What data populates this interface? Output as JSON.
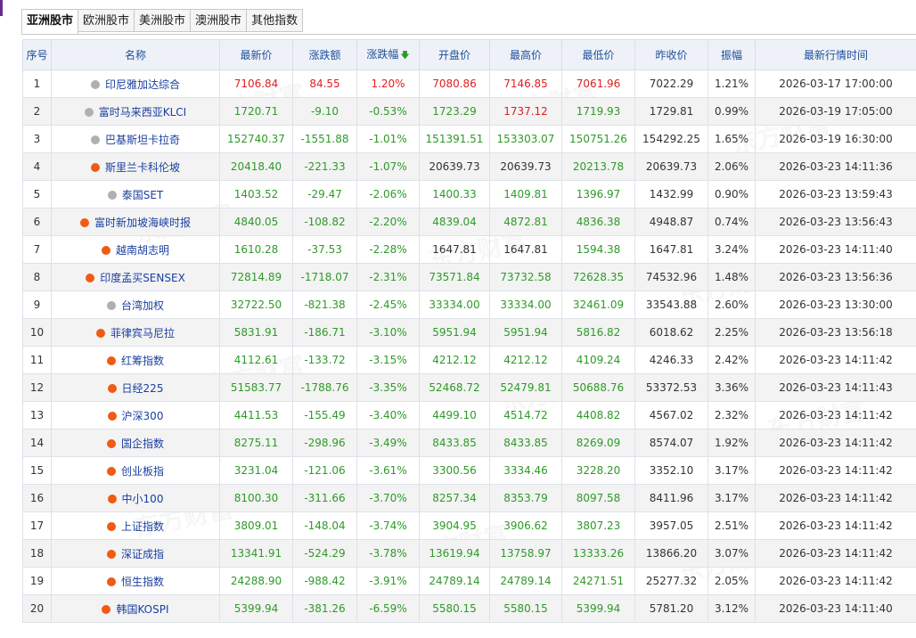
{
  "tabs": [
    "亚洲股市",
    "欧洲股市",
    "美洲股市",
    "澳洲股市",
    "其他指数"
  ],
  "active_tab": 0,
  "watermark": "东方财富",
  "columns": [
    "序号",
    "名称",
    "最新价",
    "涨跌额",
    "涨跌幅",
    "开盘价",
    "最高价",
    "最低价",
    "昨收价",
    "振幅",
    "最新行情时间"
  ],
  "colors": {
    "up": "#e02020",
    "down": "#2e9a28",
    "status_open": "#f05a14",
    "status_closed": "#b0b0b0",
    "header_text": "#1f4f9a"
  },
  "rows": [
    {
      "no": "1",
      "status": "closed",
      "name": "印尼雅加达综合",
      "price": "7106.84",
      "chg": "84.55",
      "pct": "1.20%",
      "open": "7080.86",
      "high": "7146.85",
      "low": "7061.96",
      "prev": "7022.29",
      "amp": "1.21%",
      "time": "2026-03-17 17:00:00",
      "c": {
        "price": "up",
        "chg": "up",
        "pct": "up",
        "open": "up",
        "high": "up",
        "low": "up"
      }
    },
    {
      "no": "2",
      "status": "closed",
      "name": "富时马来西亚KLCI",
      "price": "1720.71",
      "chg": "-9.10",
      "pct": "-0.53%",
      "open": "1723.29",
      "high": "1737.12",
      "low": "1719.93",
      "prev": "1729.81",
      "amp": "0.99%",
      "time": "2026-03-19 17:05:00",
      "c": {
        "price": "down",
        "chg": "down",
        "pct": "down",
        "open": "down",
        "high": "up",
        "low": "down"
      }
    },
    {
      "no": "3",
      "status": "closed",
      "name": "巴基斯坦卡拉奇",
      "price": "152740.37",
      "chg": "-1551.88",
      "pct": "-1.01%",
      "open": "151391.51",
      "high": "153303.07",
      "low": "150751.26",
      "prev": "154292.25",
      "amp": "1.65%",
      "time": "2026-03-19 16:30:00",
      "c": {
        "price": "down",
        "chg": "down",
        "pct": "down",
        "open": "down",
        "high": "down",
        "low": "down"
      }
    },
    {
      "no": "4",
      "status": "open",
      "name": "斯里兰卡科伦坡",
      "price": "20418.40",
      "chg": "-221.33",
      "pct": "-1.07%",
      "open": "20639.73",
      "high": "20639.73",
      "low": "20213.78",
      "prev": "20639.73",
      "amp": "2.06%",
      "time": "2026-03-23 14:11:36",
      "c": {
        "price": "down",
        "chg": "down",
        "pct": "down",
        "open": "flat",
        "high": "flat",
        "low": "down"
      }
    },
    {
      "no": "5",
      "status": "closed",
      "name": "泰国SET",
      "price": "1403.52",
      "chg": "-29.47",
      "pct": "-2.06%",
      "open": "1400.33",
      "high": "1409.81",
      "low": "1396.97",
      "prev": "1432.99",
      "amp": "0.90%",
      "time": "2026-03-23 13:59:43",
      "c": {
        "price": "down",
        "chg": "down",
        "pct": "down",
        "open": "down",
        "high": "down",
        "low": "down"
      }
    },
    {
      "no": "6",
      "status": "open",
      "name": "富时新加坡海峡时报",
      "price": "4840.05",
      "chg": "-108.82",
      "pct": "-2.20%",
      "open": "4839.04",
      "high": "4872.81",
      "low": "4836.38",
      "prev": "4948.87",
      "amp": "0.74%",
      "time": "2026-03-23 13:56:43",
      "c": {
        "price": "down",
        "chg": "down",
        "pct": "down",
        "open": "down",
        "high": "down",
        "low": "down"
      }
    },
    {
      "no": "7",
      "status": "open",
      "name": "越南胡志明",
      "price": "1610.28",
      "chg": "-37.53",
      "pct": "-2.28%",
      "open": "1647.81",
      "high": "1647.81",
      "low": "1594.38",
      "prev": "1647.81",
      "amp": "3.24%",
      "time": "2026-03-23 14:11:40",
      "c": {
        "price": "down",
        "chg": "down",
        "pct": "down",
        "open": "flat",
        "high": "flat",
        "low": "down"
      }
    },
    {
      "no": "8",
      "status": "open",
      "name": "印度孟买SENSEX",
      "price": "72814.89",
      "chg": "-1718.07",
      "pct": "-2.31%",
      "open": "73571.84",
      "high": "73732.58",
      "low": "72628.35",
      "prev": "74532.96",
      "amp": "1.48%",
      "time": "2026-03-23 13:56:36",
      "c": {
        "price": "down",
        "chg": "down",
        "pct": "down",
        "open": "down",
        "high": "down",
        "low": "down"
      }
    },
    {
      "no": "9",
      "status": "closed",
      "name": "台湾加权",
      "price": "32722.50",
      "chg": "-821.38",
      "pct": "-2.45%",
      "open": "33334.00",
      "high": "33334.00",
      "low": "32461.09",
      "prev": "33543.88",
      "amp": "2.60%",
      "time": "2026-03-23 13:30:00",
      "c": {
        "price": "down",
        "chg": "down",
        "pct": "down",
        "open": "down",
        "high": "down",
        "low": "down"
      }
    },
    {
      "no": "10",
      "status": "open",
      "name": "菲律宾马尼拉",
      "price": "5831.91",
      "chg": "-186.71",
      "pct": "-3.10%",
      "open": "5951.94",
      "high": "5951.94",
      "low": "5816.82",
      "prev": "6018.62",
      "amp": "2.25%",
      "time": "2026-03-23 13:56:18",
      "c": {
        "price": "down",
        "chg": "down",
        "pct": "down",
        "open": "down",
        "high": "down",
        "low": "down"
      }
    },
    {
      "no": "11",
      "status": "open",
      "name": "红筹指数",
      "price": "4112.61",
      "chg": "-133.72",
      "pct": "-3.15%",
      "open": "4212.12",
      "high": "4212.12",
      "low": "4109.24",
      "prev": "4246.33",
      "amp": "2.42%",
      "time": "2026-03-23 14:11:42",
      "c": {
        "price": "down",
        "chg": "down",
        "pct": "down",
        "open": "down",
        "high": "down",
        "low": "down"
      }
    },
    {
      "no": "12",
      "status": "open",
      "name": "日经225",
      "price": "51583.77",
      "chg": "-1788.76",
      "pct": "-3.35%",
      "open": "52468.72",
      "high": "52479.81",
      "low": "50688.76",
      "prev": "53372.53",
      "amp": "3.36%",
      "time": "2026-03-23 14:11:43",
      "c": {
        "price": "down",
        "chg": "down",
        "pct": "down",
        "open": "down",
        "high": "down",
        "low": "down"
      }
    },
    {
      "no": "13",
      "status": "open",
      "name": "沪深300",
      "price": "4411.53",
      "chg": "-155.49",
      "pct": "-3.40%",
      "open": "4499.10",
      "high": "4514.72",
      "low": "4408.82",
      "prev": "4567.02",
      "amp": "2.32%",
      "time": "2026-03-23 14:11:42",
      "c": {
        "price": "down",
        "chg": "down",
        "pct": "down",
        "open": "down",
        "high": "down",
        "low": "down"
      }
    },
    {
      "no": "14",
      "status": "open",
      "name": "国企指数",
      "price": "8275.11",
      "chg": "-298.96",
      "pct": "-3.49%",
      "open": "8433.85",
      "high": "8433.85",
      "low": "8269.09",
      "prev": "8574.07",
      "amp": "1.92%",
      "time": "2026-03-23 14:11:42",
      "c": {
        "price": "down",
        "chg": "down",
        "pct": "down",
        "open": "down",
        "high": "down",
        "low": "down"
      }
    },
    {
      "no": "15",
      "status": "open",
      "name": "创业板指",
      "price": "3231.04",
      "chg": "-121.06",
      "pct": "-3.61%",
      "open": "3300.56",
      "high": "3334.46",
      "low": "3228.20",
      "prev": "3352.10",
      "amp": "3.17%",
      "time": "2026-03-23 14:11:42",
      "c": {
        "price": "down",
        "chg": "down",
        "pct": "down",
        "open": "down",
        "high": "down",
        "low": "down"
      }
    },
    {
      "no": "16",
      "status": "open",
      "name": "中小100",
      "price": "8100.30",
      "chg": "-311.66",
      "pct": "-3.70%",
      "open": "8257.34",
      "high": "8353.79",
      "low": "8097.58",
      "prev": "8411.96",
      "amp": "3.17%",
      "time": "2026-03-23 14:11:42",
      "c": {
        "price": "down",
        "chg": "down",
        "pct": "down",
        "open": "down",
        "high": "down",
        "low": "down"
      }
    },
    {
      "no": "17",
      "status": "open",
      "name": "上证指数",
      "price": "3809.01",
      "chg": "-148.04",
      "pct": "-3.74%",
      "open": "3904.95",
      "high": "3906.62",
      "low": "3807.23",
      "prev": "3957.05",
      "amp": "2.51%",
      "time": "2026-03-23 14:11:42",
      "c": {
        "price": "down",
        "chg": "down",
        "pct": "down",
        "open": "down",
        "high": "down",
        "low": "down"
      }
    },
    {
      "no": "18",
      "status": "open",
      "name": "深证成指",
      "price": "13341.91",
      "chg": "-524.29",
      "pct": "-3.78%",
      "open": "13619.94",
      "high": "13758.97",
      "low": "13333.26",
      "prev": "13866.20",
      "amp": "3.07%",
      "time": "2026-03-23 14:11:42",
      "c": {
        "price": "down",
        "chg": "down",
        "pct": "down",
        "open": "down",
        "high": "down",
        "low": "down"
      }
    },
    {
      "no": "19",
      "status": "open",
      "name": "恒生指数",
      "price": "24288.90",
      "chg": "-988.42",
      "pct": "-3.91%",
      "open": "24789.14",
      "high": "24789.14",
      "low": "24271.51",
      "prev": "25277.32",
      "amp": "2.05%",
      "time": "2026-03-23 14:11:42",
      "c": {
        "price": "down",
        "chg": "down",
        "pct": "down",
        "open": "down",
        "high": "down",
        "low": "down"
      }
    },
    {
      "no": "20",
      "status": "open",
      "name": "韩国KOSPI",
      "price": "5399.94",
      "chg": "-381.26",
      "pct": "-6.59%",
      "open": "5580.15",
      "high": "5580.15",
      "low": "5399.94",
      "prev": "5781.20",
      "amp": "3.12%",
      "time": "2026-03-23 14:11:40",
      "c": {
        "price": "down",
        "chg": "down",
        "pct": "down",
        "open": "down",
        "high": "down",
        "low": "down"
      }
    }
  ]
}
